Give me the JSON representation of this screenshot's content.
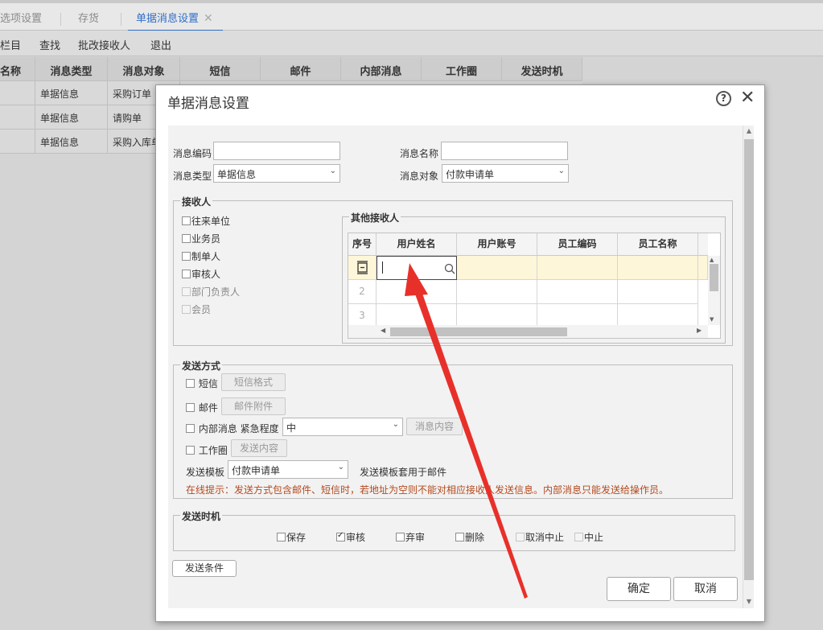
{
  "tabs": [
    {
      "label": "选项设置"
    },
    {
      "label": "存货"
    },
    {
      "label": "单据消息设置",
      "close": "✕"
    }
  ],
  "toolbar": {
    "items": [
      "栏目",
      "查找",
      "批改接收人",
      "退出"
    ]
  },
  "bg_table": {
    "headers": [
      "名称",
      "消息类型",
      "消息对象",
      "短信",
      "邮件",
      "内部消息",
      "工作圈",
      "发送时机"
    ],
    "rows": [
      [
        "",
        "单据信息",
        "采购订单"
      ],
      [
        "",
        "单据信息",
        "请购单"
      ],
      [
        "",
        "单据信息",
        "采购入库单"
      ]
    ]
  },
  "dialog": {
    "title": "单据消息设置",
    "help_icon": "?",
    "close_icon": "✕",
    "fields": {
      "code_label": "消息编码",
      "code_value": "",
      "name_label": "消息名称",
      "name_value": "",
      "type_label": "消息类型",
      "type_value": "单据信息",
      "object_label": "消息对象",
      "object_value": "付款申请单"
    },
    "receivers": {
      "legend": "接收人",
      "options": [
        {
          "label": "往来单位",
          "disabled": false
        },
        {
          "label": "业务员",
          "disabled": false
        },
        {
          "label": "制单人",
          "disabled": false
        },
        {
          "label": "审核人",
          "disabled": false
        },
        {
          "label": "部门负责人",
          "disabled": true
        },
        {
          "label": "会员",
          "disabled": true
        }
      ],
      "other_legend": "其他接收人",
      "grid_headers": [
        "序号",
        "用户姓名",
        "用户账号",
        "员工编码",
        "员工名称"
      ],
      "row_numbers": [
        "2",
        "3"
      ]
    },
    "send_method": {
      "legend": "发送方式",
      "sms_label": "短信",
      "sms_btn": "短信格式",
      "mail_label": "邮件",
      "mail_btn": "邮件附件",
      "internal_label": "内部消息",
      "urgency_label": "紧急程度",
      "urgency_value": "中",
      "internal_btn": "消息内容",
      "circle_label": "工作圈",
      "circle_btn": "发送内容",
      "template_label": "发送模板",
      "template_value": "付款申请单",
      "template_note": "发送模板套用于邮件",
      "hint": "在线提示：发送方式包含邮件、短信时，若地址为空则不能对相应接收人发送信息。内部消息只能发送给操作员。"
    },
    "timing": {
      "legend": "发送时机",
      "options": [
        {
          "label": "保存",
          "checked": false,
          "disabled": false
        },
        {
          "label": "审核",
          "checked": true,
          "disabled": false
        },
        {
          "label": "弃审",
          "checked": false,
          "disabled": false
        },
        {
          "label": "删除",
          "checked": false,
          "disabled": false
        },
        {
          "label": "取消中止",
          "checked": false,
          "disabled": true
        },
        {
          "label": "中止",
          "checked": false,
          "disabled": true
        }
      ]
    },
    "condition_btn": "发送条件",
    "ok_btn": "确定",
    "cancel_btn": "取消"
  },
  "colors": {
    "accent": "#2f6fc7",
    "hint": "#b44a1e",
    "arrow": "#e8302a",
    "selected_row": "#fdf6d8"
  }
}
